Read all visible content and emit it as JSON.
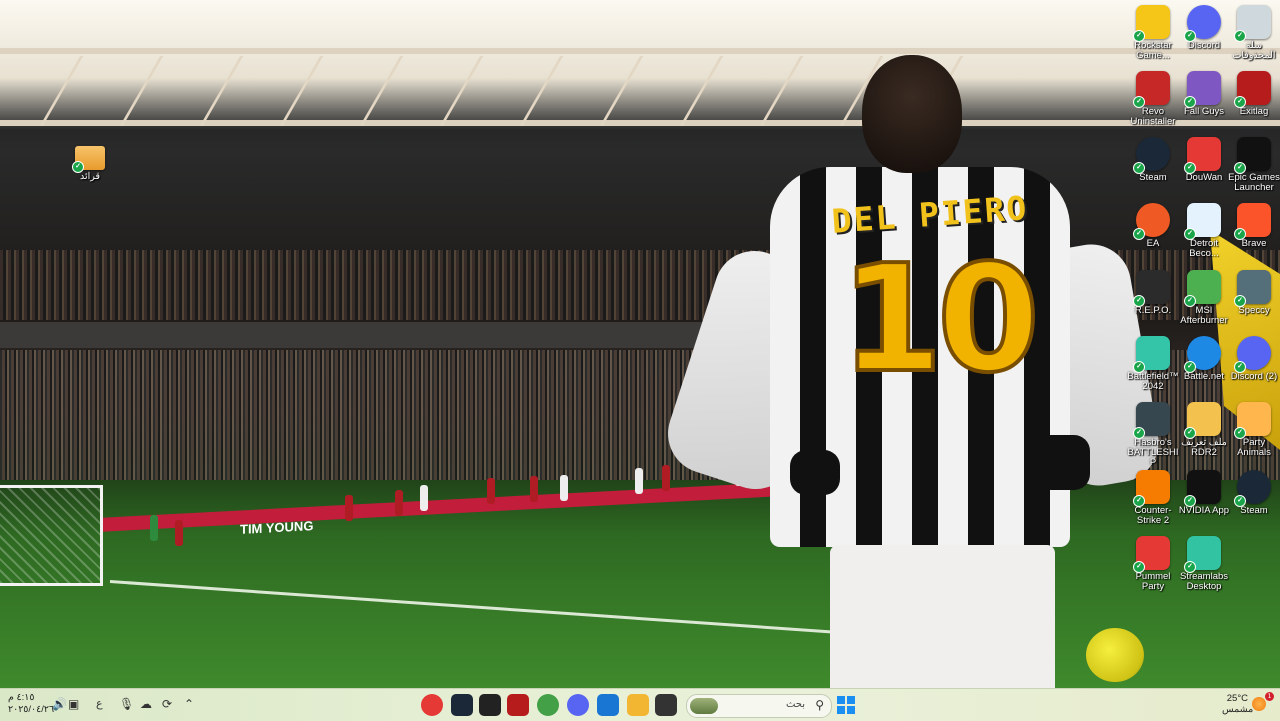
{
  "wallpaper": {
    "jersey_name": "DEL PIERO",
    "jersey_number": "10",
    "ad_text": "TIM YOUNG"
  },
  "desktop": {
    "left_icons": [
      {
        "id": "folder-qarar",
        "label": "قرائد",
        "icon": "folder-icon",
        "color": "#f2a93b"
      }
    ],
    "right_icons": [
      {
        "id": "rockstar",
        "label": "Rockstar Game...",
        "icon": "rockstar-icon",
        "color": "#f5c518"
      },
      {
        "id": "discord-1",
        "label": "Discord",
        "icon": "discord-icon",
        "color": "#5865f2"
      },
      {
        "id": "recycle-bin",
        "label": "سلة المحذوفات",
        "icon": "recycle-bin-icon",
        "color": "#cfd8dc"
      },
      {
        "id": "revo",
        "label": "Revo Uninstaller",
        "icon": "revo-icon",
        "color": "#c62828"
      },
      {
        "id": "fall-guys",
        "label": "Fall Guys",
        "icon": "fall-guys-icon",
        "color": "#7e57c2"
      },
      {
        "id": "exitlag",
        "label": "Exitlag",
        "icon": "exitlag-icon",
        "color": "#b71c1c"
      },
      {
        "id": "steam-1",
        "label": "Steam",
        "icon": "steam-icon",
        "color": "#1b2838"
      },
      {
        "id": "douwan",
        "label": "DouWan",
        "icon": "douwan-icon",
        "color": "#e53935"
      },
      {
        "id": "epic",
        "label": "Epic Games Launcher",
        "icon": "epic-games-icon",
        "color": "#111111"
      },
      {
        "id": "ea",
        "label": "EA",
        "icon": "ea-icon",
        "color": "#ef5a24"
      },
      {
        "id": "detroit",
        "label": "Detroit Beco...",
        "icon": "detroit-icon",
        "color": "#e3f2fd"
      },
      {
        "id": "brave",
        "label": "Brave",
        "icon": "brave-icon",
        "color": "#fb542b"
      },
      {
        "id": "repo",
        "label": "R.E.P.O.",
        "icon": "repo-icon",
        "color": "#2b2b2b"
      },
      {
        "id": "msi",
        "label": "MSI Afterburner",
        "icon": "msi-afterburner-icon",
        "color": "#4caf50"
      },
      {
        "id": "speccy",
        "label": "Speccy",
        "icon": "speccy-icon",
        "color": "#546e7a"
      },
      {
        "id": "bf2042",
        "label": "Battlefield™ 2042",
        "icon": "battlefield-icon",
        "color": "#34c4a8"
      },
      {
        "id": "battlenet",
        "label": "Battle.net",
        "icon": "battlenet-icon",
        "color": "#1e88e5"
      },
      {
        "id": "discord-2",
        "label": "Discord (2)",
        "icon": "discord-icon",
        "color": "#5865f2"
      },
      {
        "id": "battleship",
        "label": "Hasbro's BATTLESHIP",
        "icon": "battleship-icon",
        "color": "#37474f"
      },
      {
        "id": "rdr2",
        "label": "ملف تعريف RDR2",
        "icon": "folder-icon",
        "color": "#f2c14e"
      },
      {
        "id": "party-animals",
        "label": "Party Animals",
        "icon": "party-animals-icon",
        "color": "#ffb74d"
      },
      {
        "id": "cs2",
        "label": "Counter-Strike 2",
        "icon": "counter-strike-icon",
        "color": "#f57c00"
      },
      {
        "id": "nvidia",
        "label": "NVIDIA App",
        "icon": "nvidia-icon",
        "color": "#111111"
      },
      {
        "id": "steam-2",
        "label": "Steam",
        "icon": "steam-icon",
        "color": "#1b2838"
      },
      {
        "id": "pummel",
        "label": "Pummel Party",
        "icon": "pummel-party-icon",
        "color": "#e53935"
      },
      {
        "id": "streamlabs",
        "label": "Streamlabs Desktop",
        "icon": "streamlabs-icon",
        "color": "#31c3a2"
      }
    ]
  },
  "taskbar": {
    "clock_time": "٤:١٥ م",
    "clock_date": "٢٠٢٥/٠٤/٢٦",
    "lang": "ع",
    "search_placeholder": "بحث",
    "weather_temp": "25°C",
    "weather_desc": "مشمس",
    "notification_count": "1",
    "apps": [
      {
        "name": "chrome-profile-icon",
        "color": "#e53935"
      },
      {
        "name": "steam-icon",
        "color": "#1b2838"
      },
      {
        "name": "game-icon",
        "color": "#222222"
      },
      {
        "name": "exitlag-icon",
        "color": "#b71c1c"
      },
      {
        "name": "chrome-icon",
        "color": "#43a047"
      },
      {
        "name": "discord-icon",
        "color": "#5865f2"
      },
      {
        "name": "store-icon",
        "color": "#1976d2"
      },
      {
        "name": "file-explorer-icon",
        "color": "#f2b632"
      },
      {
        "name": "terminal-icon",
        "color": "#333333"
      }
    ]
  }
}
